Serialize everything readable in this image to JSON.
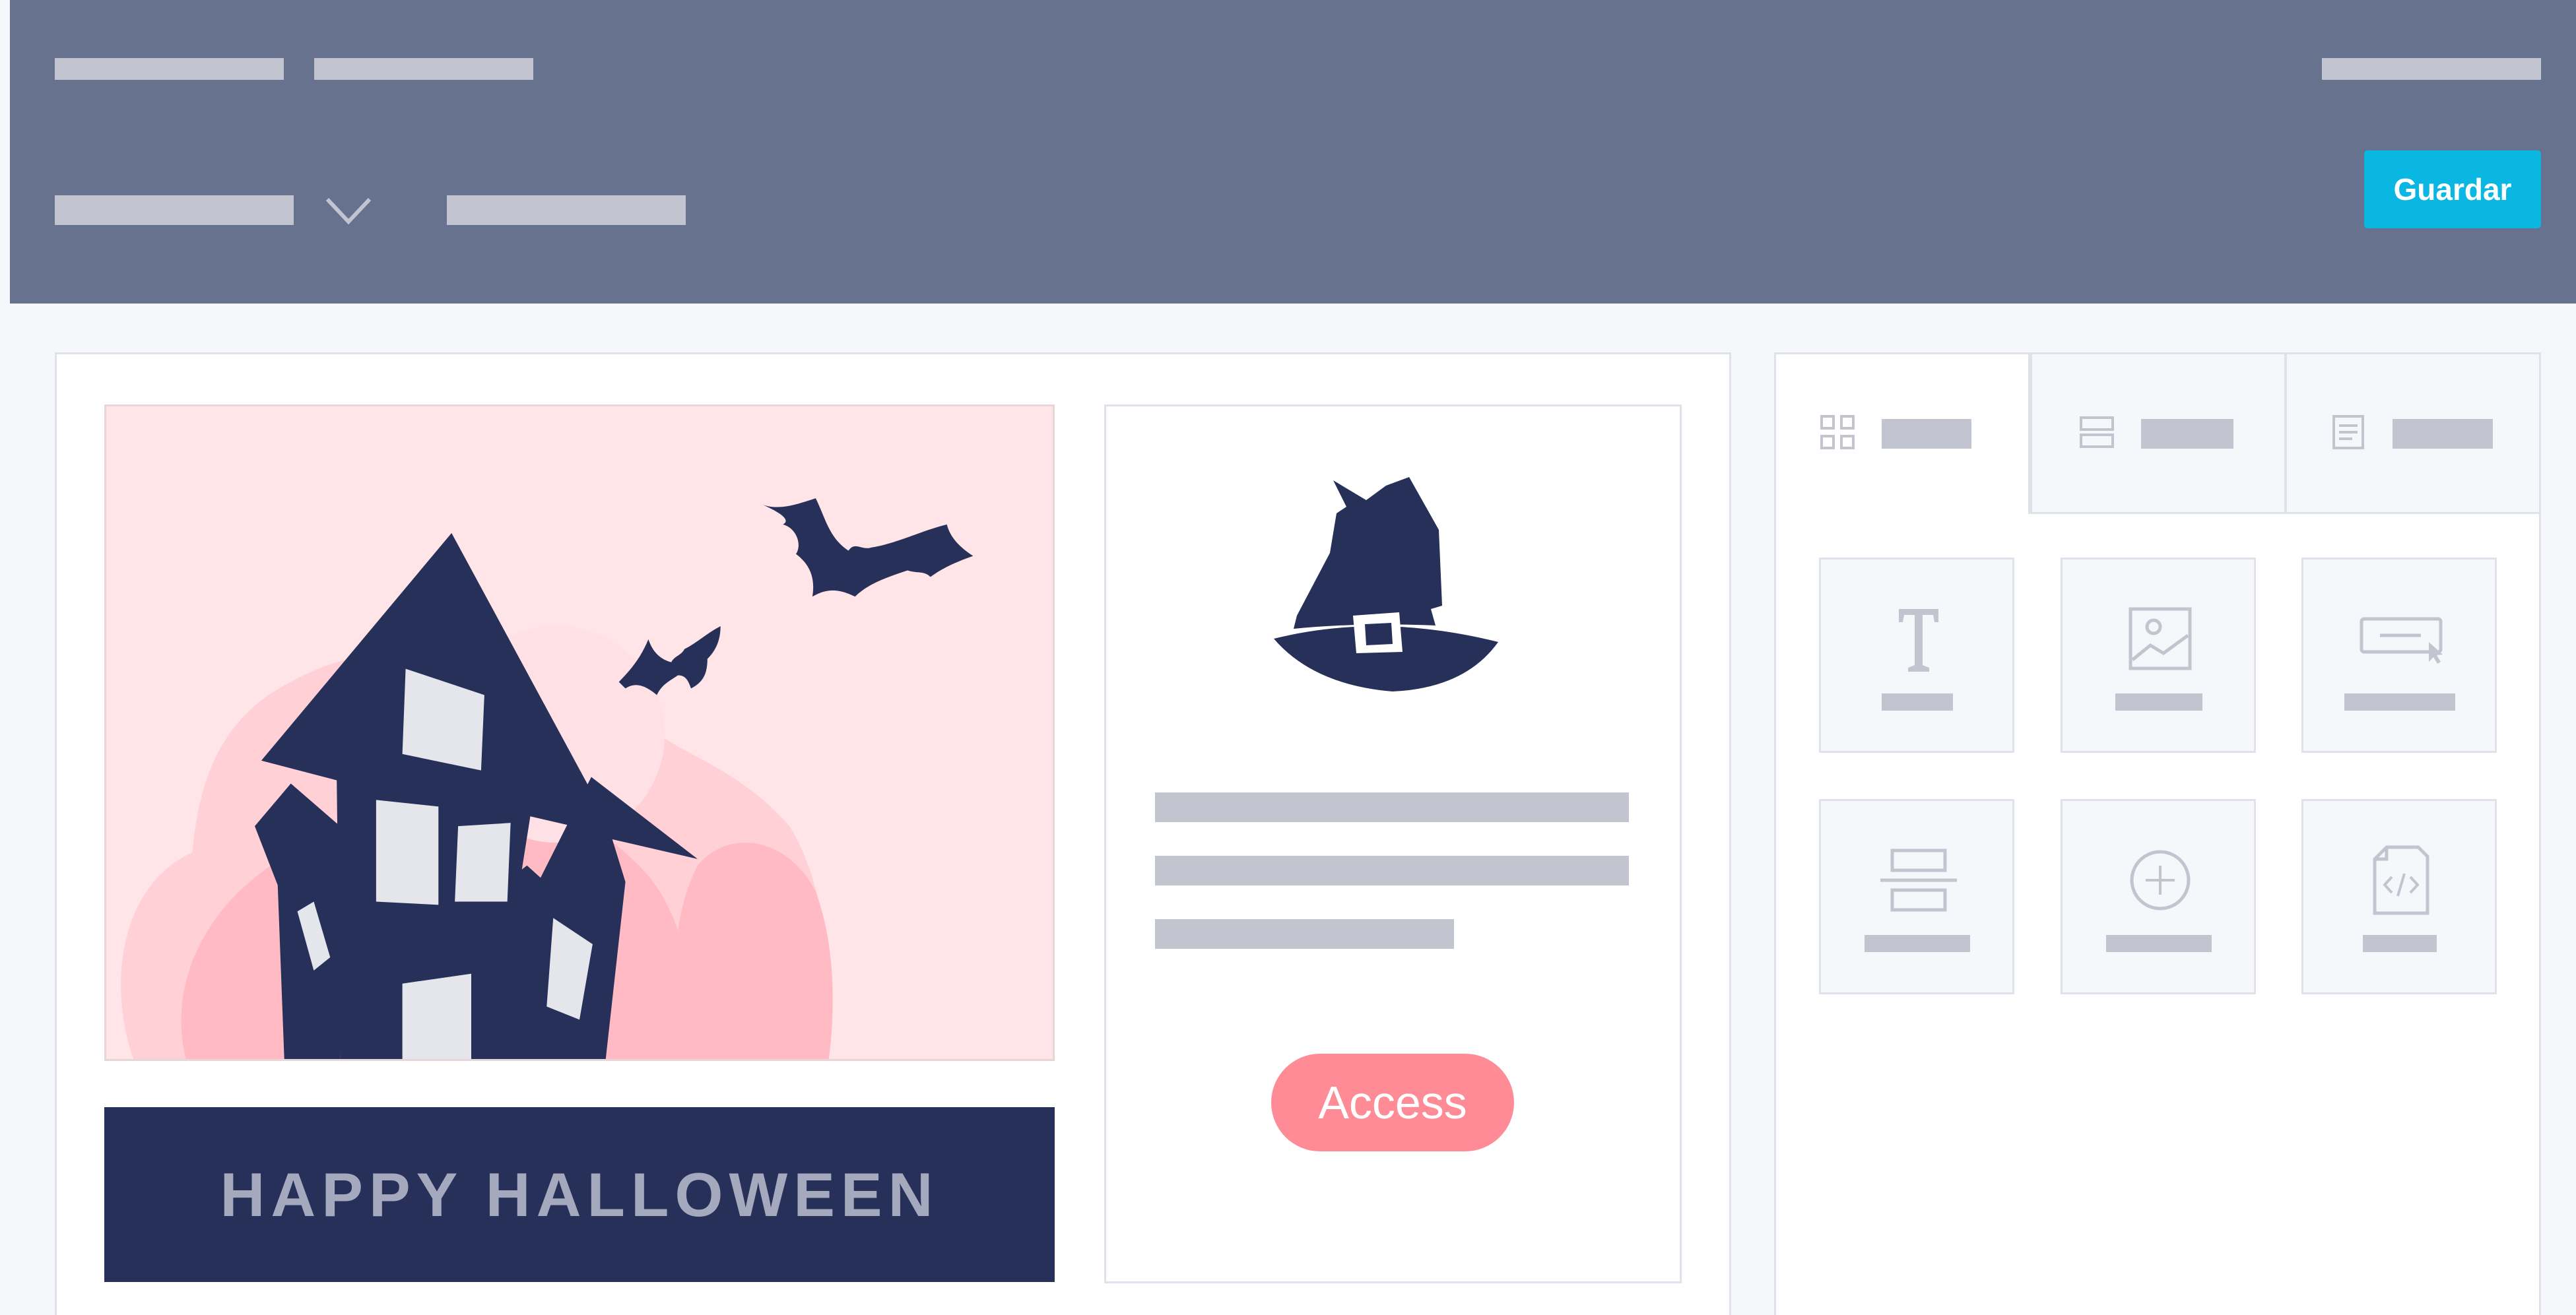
{
  "toolbar": {
    "save_label": "Guardar"
  },
  "email": {
    "banner_title": "HAPPY HALLOWEEN",
    "button_label": "Access"
  },
  "icons": {
    "dropdown": "chevron-down-icon",
    "tab_blocks": "grid-icon",
    "tab_rows": "rows-icon",
    "tab_settings": "document-icon",
    "text_block": "text-icon",
    "image_block": "image-icon",
    "button_block": "button-icon",
    "divider_block": "divider-icon",
    "social_block": "plus-circle-icon",
    "html_block": "html-file-icon"
  },
  "colors": {
    "header": "#67728f",
    "accent": "#0ab7e3",
    "banner": "#263059",
    "cta": "#ff8b96",
    "hero_bg": "#ffe5e8"
  }
}
